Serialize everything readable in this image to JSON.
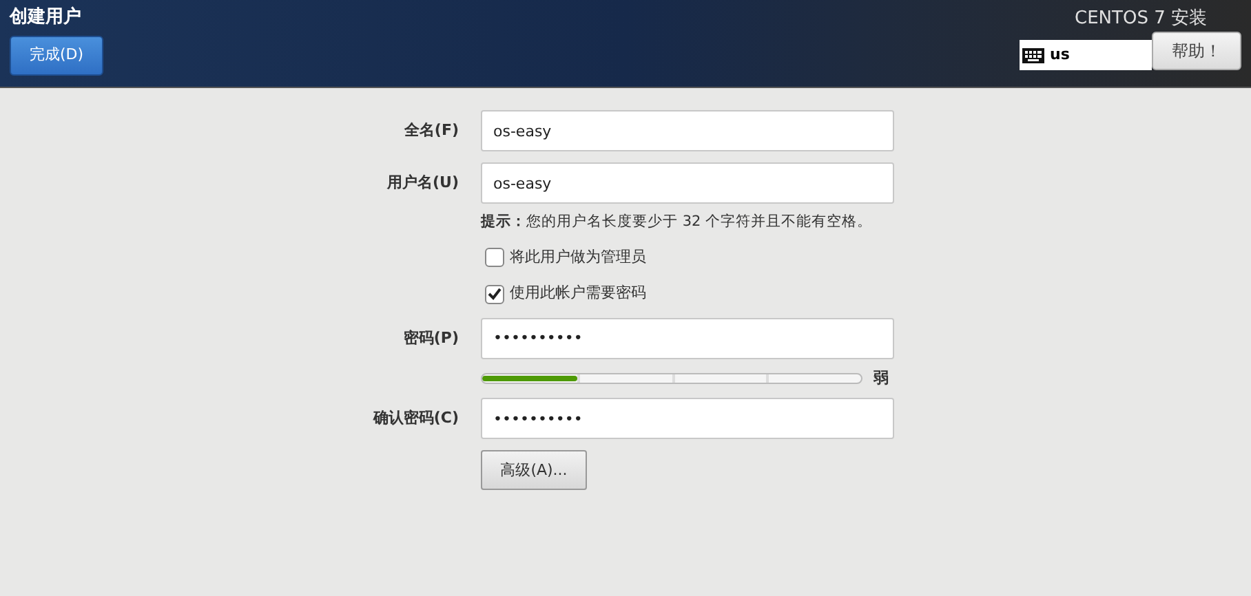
{
  "header": {
    "title": "创建用户",
    "done_button": "完成(D)",
    "product": "CENTOS 7 安装",
    "keyboard_layout": "us",
    "help_button": "帮助！"
  },
  "form": {
    "fields": [
      {
        "label": "全名(F)",
        "value": "os-easy"
      },
      {
        "label": "用户名(U)",
        "value": "os-easy"
      }
    ],
    "hint": "**提示：**您的用户名长度要少于 32 个字符并且不能有空格。",
    "checkboxes": [
      {
        "label": "将此用户做为管理员",
        "checked": false
      },
      {
        "label": "使用此帐户需要密码",
        "checked": true
      }
    ],
    "password": {
      "label": "密码(P)",
      "value": "••••••••••"
    },
    "strength": {
      "level": 0.25,
      "reading": "弱"
    },
    "confirm": {
      "label": "确认密码(C)",
      "value": "••••••••••"
    },
    "advanced_button": "高级(A)..."
  }
}
